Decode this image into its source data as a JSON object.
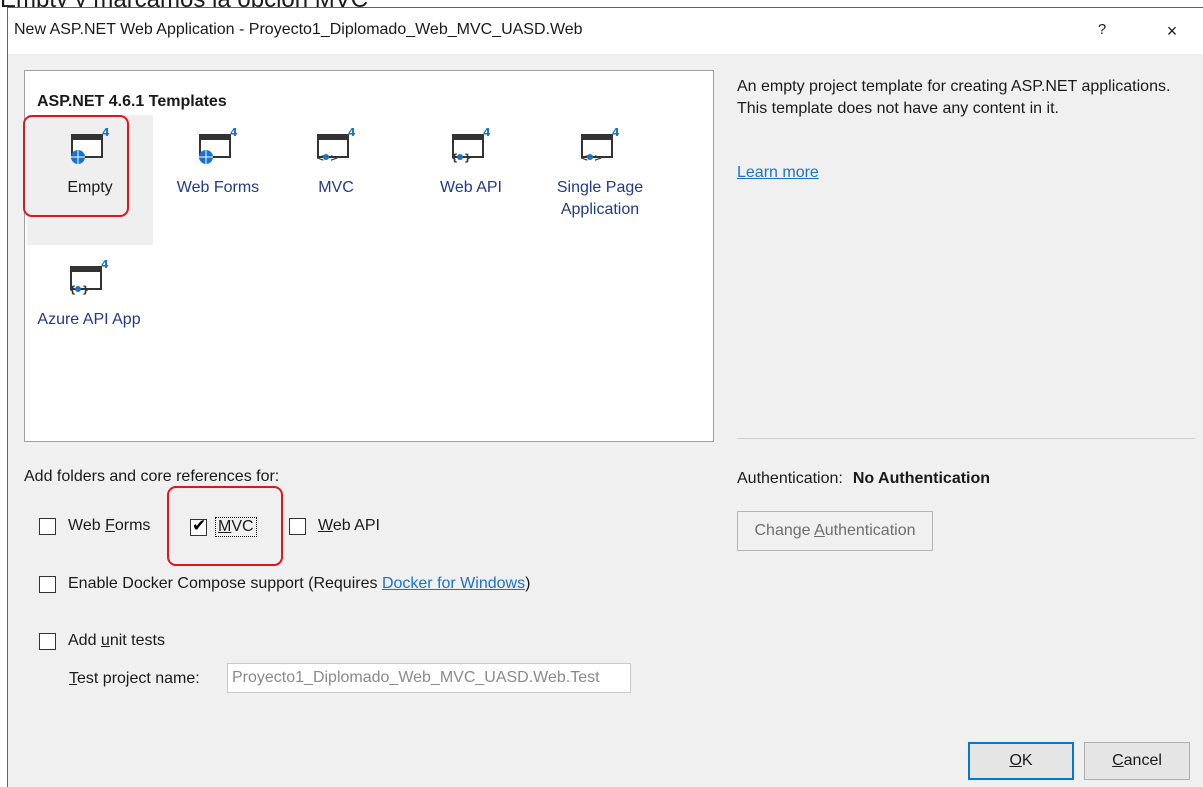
{
  "overlay_text": "Empty y marcamos la opción MVC",
  "window": {
    "title": "New ASP.NET Web Application - Proyecto1_Diplomado_Web_MVC_UASD.Web",
    "help_label": "?",
    "close_label": "×"
  },
  "templates": {
    "heading": "ASP.NET 4.6.1 Templates",
    "selected": "Empty",
    "items": [
      {
        "label": "Empty",
        "icon": "web-globe-project-icon"
      },
      {
        "label": "Web Forms",
        "icon": "web-globe-project-icon"
      },
      {
        "label": "MVC",
        "icon": "mvc-project-icon"
      },
      {
        "label": "Web API",
        "icon": "webapi-project-icon"
      },
      {
        "label": "Single Page Application",
        "line1": "Single Page",
        "line2": "Application",
        "icon": "mvc-project-icon"
      },
      {
        "label": "Azure API App",
        "icon": "webapi-project-icon"
      }
    ]
  },
  "description": {
    "text": "An empty project template for creating ASP.NET applications. This template does not have any content in it.",
    "learn_more": "Learn more"
  },
  "folders": {
    "label": "Add folders and core references for:",
    "web_forms": {
      "label": "Web Forms",
      "checked": false
    },
    "mvc": {
      "label": "MVC",
      "checked": true
    },
    "web_api": {
      "label": "Web API",
      "checked": false
    }
  },
  "docker": {
    "label_prefix": "Enable Docker Compose support (Requires ",
    "link": "Docker for Windows",
    "label_suffix": ")",
    "checked": false
  },
  "unit_tests": {
    "label": "Add unit tests",
    "checked": false,
    "test_name_label": "Test project name:",
    "test_name_value": "Proyecto1_Diplomado_Web_MVC_UASD.Web.Test"
  },
  "authentication": {
    "label": "Authentication:",
    "value": "No Authentication",
    "change_button": "Change Authentication"
  },
  "buttons": {
    "ok": "OK",
    "cancel": "Cancel"
  },
  "colors": {
    "accent": "#0078d7",
    "highlight": "#e0161b",
    "link": "#1a73c9"
  }
}
